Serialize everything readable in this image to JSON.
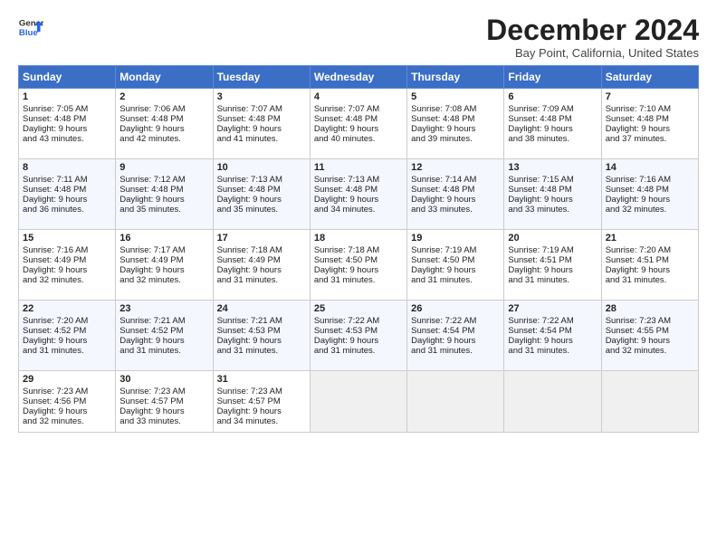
{
  "header": {
    "logo_line1": "General",
    "logo_line2": "Blue",
    "title": "December 2024",
    "subtitle": "Bay Point, California, United States"
  },
  "days_of_week": [
    "Sunday",
    "Monday",
    "Tuesday",
    "Wednesday",
    "Thursday",
    "Friday",
    "Saturday"
  ],
  "weeks": [
    [
      {
        "day": "1",
        "lines": [
          "Sunrise: 7:05 AM",
          "Sunset: 4:48 PM",
          "Daylight: 9 hours",
          "and 43 minutes."
        ]
      },
      {
        "day": "2",
        "lines": [
          "Sunrise: 7:06 AM",
          "Sunset: 4:48 PM",
          "Daylight: 9 hours",
          "and 42 minutes."
        ]
      },
      {
        "day": "3",
        "lines": [
          "Sunrise: 7:07 AM",
          "Sunset: 4:48 PM",
          "Daylight: 9 hours",
          "and 41 minutes."
        ]
      },
      {
        "day": "4",
        "lines": [
          "Sunrise: 7:07 AM",
          "Sunset: 4:48 PM",
          "Daylight: 9 hours",
          "and 40 minutes."
        ]
      },
      {
        "day": "5",
        "lines": [
          "Sunrise: 7:08 AM",
          "Sunset: 4:48 PM",
          "Daylight: 9 hours",
          "and 39 minutes."
        ]
      },
      {
        "day": "6",
        "lines": [
          "Sunrise: 7:09 AM",
          "Sunset: 4:48 PM",
          "Daylight: 9 hours",
          "and 38 minutes."
        ]
      },
      {
        "day": "7",
        "lines": [
          "Sunrise: 7:10 AM",
          "Sunset: 4:48 PM",
          "Daylight: 9 hours",
          "and 37 minutes."
        ]
      }
    ],
    [
      {
        "day": "8",
        "lines": [
          "Sunrise: 7:11 AM",
          "Sunset: 4:48 PM",
          "Daylight: 9 hours",
          "and 36 minutes."
        ]
      },
      {
        "day": "9",
        "lines": [
          "Sunrise: 7:12 AM",
          "Sunset: 4:48 PM",
          "Daylight: 9 hours",
          "and 35 minutes."
        ]
      },
      {
        "day": "10",
        "lines": [
          "Sunrise: 7:13 AM",
          "Sunset: 4:48 PM",
          "Daylight: 9 hours",
          "and 35 minutes."
        ]
      },
      {
        "day": "11",
        "lines": [
          "Sunrise: 7:13 AM",
          "Sunset: 4:48 PM",
          "Daylight: 9 hours",
          "and 34 minutes."
        ]
      },
      {
        "day": "12",
        "lines": [
          "Sunrise: 7:14 AM",
          "Sunset: 4:48 PM",
          "Daylight: 9 hours",
          "and 33 minutes."
        ]
      },
      {
        "day": "13",
        "lines": [
          "Sunrise: 7:15 AM",
          "Sunset: 4:48 PM",
          "Daylight: 9 hours",
          "and 33 minutes."
        ]
      },
      {
        "day": "14",
        "lines": [
          "Sunrise: 7:16 AM",
          "Sunset: 4:48 PM",
          "Daylight: 9 hours",
          "and 32 minutes."
        ]
      }
    ],
    [
      {
        "day": "15",
        "lines": [
          "Sunrise: 7:16 AM",
          "Sunset: 4:49 PM",
          "Daylight: 9 hours",
          "and 32 minutes."
        ]
      },
      {
        "day": "16",
        "lines": [
          "Sunrise: 7:17 AM",
          "Sunset: 4:49 PM",
          "Daylight: 9 hours",
          "and 32 minutes."
        ]
      },
      {
        "day": "17",
        "lines": [
          "Sunrise: 7:18 AM",
          "Sunset: 4:49 PM",
          "Daylight: 9 hours",
          "and 31 minutes."
        ]
      },
      {
        "day": "18",
        "lines": [
          "Sunrise: 7:18 AM",
          "Sunset: 4:50 PM",
          "Daylight: 9 hours",
          "and 31 minutes."
        ]
      },
      {
        "day": "19",
        "lines": [
          "Sunrise: 7:19 AM",
          "Sunset: 4:50 PM",
          "Daylight: 9 hours",
          "and 31 minutes."
        ]
      },
      {
        "day": "20",
        "lines": [
          "Sunrise: 7:19 AM",
          "Sunset: 4:51 PM",
          "Daylight: 9 hours",
          "and 31 minutes."
        ]
      },
      {
        "day": "21",
        "lines": [
          "Sunrise: 7:20 AM",
          "Sunset: 4:51 PM",
          "Daylight: 9 hours",
          "and 31 minutes."
        ]
      }
    ],
    [
      {
        "day": "22",
        "lines": [
          "Sunrise: 7:20 AM",
          "Sunset: 4:52 PM",
          "Daylight: 9 hours",
          "and 31 minutes."
        ]
      },
      {
        "day": "23",
        "lines": [
          "Sunrise: 7:21 AM",
          "Sunset: 4:52 PM",
          "Daylight: 9 hours",
          "and 31 minutes."
        ]
      },
      {
        "day": "24",
        "lines": [
          "Sunrise: 7:21 AM",
          "Sunset: 4:53 PM",
          "Daylight: 9 hours",
          "and 31 minutes."
        ]
      },
      {
        "day": "25",
        "lines": [
          "Sunrise: 7:22 AM",
          "Sunset: 4:53 PM",
          "Daylight: 9 hours",
          "and 31 minutes."
        ]
      },
      {
        "day": "26",
        "lines": [
          "Sunrise: 7:22 AM",
          "Sunset: 4:54 PM",
          "Daylight: 9 hours",
          "and 31 minutes."
        ]
      },
      {
        "day": "27",
        "lines": [
          "Sunrise: 7:22 AM",
          "Sunset: 4:54 PM",
          "Daylight: 9 hours",
          "and 31 minutes."
        ]
      },
      {
        "day": "28",
        "lines": [
          "Sunrise: 7:23 AM",
          "Sunset: 4:55 PM",
          "Daylight: 9 hours",
          "and 32 minutes."
        ]
      }
    ],
    [
      {
        "day": "29",
        "lines": [
          "Sunrise: 7:23 AM",
          "Sunset: 4:56 PM",
          "Daylight: 9 hours",
          "and 32 minutes."
        ]
      },
      {
        "day": "30",
        "lines": [
          "Sunrise: 7:23 AM",
          "Sunset: 4:57 PM",
          "Daylight: 9 hours",
          "and 33 minutes."
        ]
      },
      {
        "day": "31",
        "lines": [
          "Sunrise: 7:23 AM",
          "Sunset: 4:57 PM",
          "Daylight: 9 hours",
          "and 34 minutes."
        ]
      },
      null,
      null,
      null,
      null
    ]
  ]
}
